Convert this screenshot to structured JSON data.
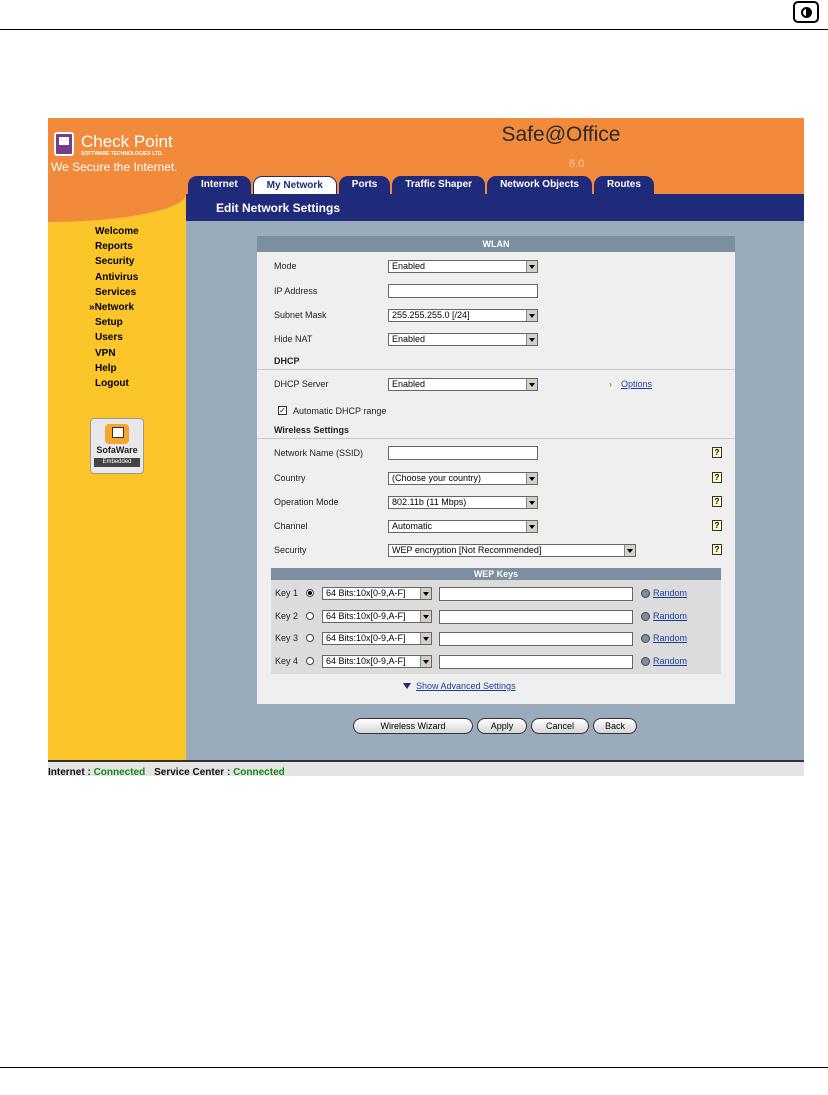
{
  "brand": {
    "name": "Check Point",
    "sub": "SOFTWARE TECHNOLOGIES LTD.",
    "tagline": "We Secure the Internet.",
    "product": "Safe@Office",
    "version": "6.0"
  },
  "tabs": [
    {
      "label": "Internet",
      "active": false
    },
    {
      "label": "My Network",
      "active": true
    },
    {
      "label": "Ports",
      "active": false
    },
    {
      "label": "Traffic Shaper",
      "active": false
    },
    {
      "label": "Network Objects",
      "active": false
    },
    {
      "label": "Routes",
      "active": false
    }
  ],
  "nav": {
    "items": [
      "Welcome",
      "Reports",
      "Security",
      "Antivirus",
      "Services",
      "Network",
      "Setup",
      "Users",
      "VPN",
      "Help",
      "Logout"
    ],
    "current_index": 5,
    "current_marker": "»"
  },
  "sofaware": {
    "name": "SofaWare",
    "sub": "Embedded"
  },
  "page_title": "Edit Network Settings",
  "panel": {
    "title": "WLAN",
    "mode": {
      "label": "Mode",
      "value": "Enabled"
    },
    "ip": {
      "label": "IP Address",
      "value": ""
    },
    "subnet": {
      "label": "Subnet Mask",
      "value": "255.255.255.0 [/24]"
    },
    "hide_nat": {
      "label": "Hide NAT",
      "value": "Enabled"
    },
    "dhcp_section": "DHCP",
    "dhcp_server": {
      "label": "DHCP Server",
      "value": "Enabled"
    },
    "options_label": "Options",
    "options_arrow": "›",
    "auto_dhcp": {
      "label": "Automatic DHCP range",
      "checked": true,
      "mark": "✓"
    },
    "wireless_section": "Wireless Settings",
    "ssid": {
      "label": "Network Name (SSID)",
      "value": ""
    },
    "country": {
      "label": "Country",
      "value": "(Choose your country)"
    },
    "op_mode": {
      "label": "Operation Mode",
      "value": "802.11b (11 Mbps)"
    },
    "channel": {
      "label": "Channel",
      "value": "Automatic"
    },
    "security": {
      "label": "Security",
      "value": "WEP encryption [Not Recommended]"
    },
    "help_glyph": "?",
    "wep": {
      "title": "WEP Keys",
      "keys": [
        {
          "label": "Key 1",
          "selected": true,
          "size": "64 Bits:10x[0-9,A-F]",
          "value": "",
          "random": "Random"
        },
        {
          "label": "Key 2",
          "selected": false,
          "size": "64 Bits:10x[0-9,A-F]",
          "value": "",
          "random": "Random"
        },
        {
          "label": "Key 3",
          "selected": false,
          "size": "64 Bits:10x[0-9,A-F]",
          "value": "",
          "random": "Random"
        },
        {
          "label": "Key 4",
          "selected": false,
          "size": "64 Bits:10x[0-9,A-F]",
          "value": "",
          "random": "Random"
        }
      ]
    },
    "advanced_label": "Show Advanced Settings"
  },
  "buttons": {
    "wizard": "Wireless Wizard",
    "apply": "Apply",
    "cancel": "Cancel",
    "back": "Back"
  },
  "status": {
    "internet_label": "Internet : ",
    "internet_value": "Connected",
    "service_label": "Service Center : ",
    "service_value": "Connected"
  },
  "colors": {
    "header": "#f28a3c",
    "nav": "#fcc62a",
    "title_bar": "#1f2a7a",
    "content_bg": "#9aacbc",
    "connected": "#178a17"
  }
}
